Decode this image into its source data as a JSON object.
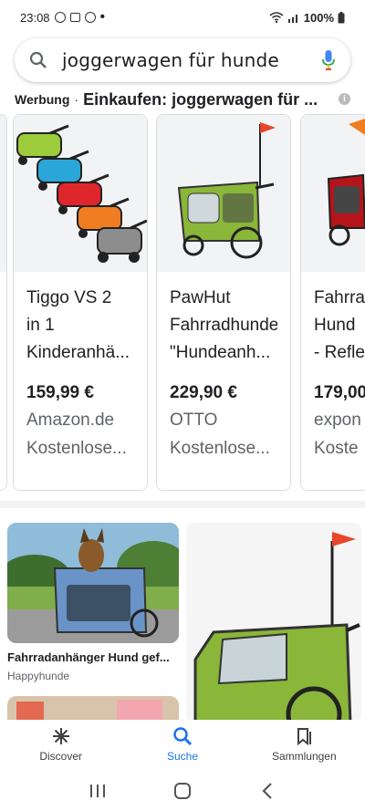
{
  "status": {
    "time": "23:08",
    "battery": "100%"
  },
  "search": {
    "query": "joggerwagen für hunde"
  },
  "ad": {
    "label": "Werbung",
    "separator": "·",
    "title": "Einkaufen: joggerwagen für ..."
  },
  "products": [
    {
      "title": "Tiggo VS 2\nin 1\nKinderanhä...",
      "price": "159,99 €",
      "store": "Amazon.de",
      "shipping": "Kostenlose..."
    },
    {
      "title": "PawHut\nFahrradhunde\n\"Hundeanh...",
      "price": "229,90 €",
      "store": "OTTO",
      "shipping": "Kostenlose..."
    },
    {
      "title": "Fahrra\nHund\n- Refle",
      "price": "179,00",
      "store": "expon",
      "shipping": "Koste"
    }
  ],
  "feed": {
    "left_title": "Fahrradanhänger Hund gef...",
    "left_source": "Happyhunde"
  },
  "nav": {
    "discover": "Discover",
    "search": "Suche",
    "collections": "Sammlungen"
  },
  "colors": {
    "accent": "#1a73e8",
    "trailer_green": "#8ab63a",
    "flag_red": "#e8452b"
  }
}
